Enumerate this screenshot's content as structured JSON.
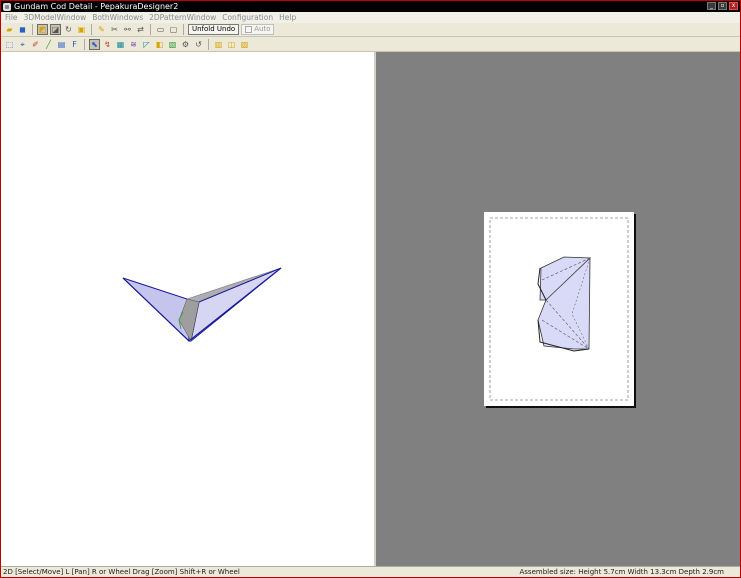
{
  "window": {
    "title": "Gundam Cod Detail - PepakuraDesigner2",
    "controls": [
      "_",
      "▫",
      "x"
    ]
  },
  "menu": [
    "File",
    "3DModelWindow",
    "BothWindows",
    "2DPatternWindow",
    "Configuration",
    "Help"
  ],
  "toolbar1": {
    "unfold_undo_label": "Unfold Undo",
    "auto_label": "Auto"
  },
  "icons": {
    "toolbar1": [
      "open-icon",
      "save-icon",
      "texture-on-icon",
      "shade-icon",
      "rotate-icon",
      "box-icon",
      "pencil-icon",
      "cut-icon",
      "join-icon",
      "move-part-icon",
      "page-single-icon",
      "page-fit-icon"
    ],
    "toolbar2": [
      "select-icon",
      "ruler-icon",
      "paint-icon",
      "line-icon",
      "edge-icon",
      "text-icon",
      "image-icon",
      "fold-icon",
      "chart-icon",
      "sort-icon",
      "flap-icon",
      "rotate-part-icon",
      "layer-icon",
      "zoom-icon",
      "pan-icon",
      "grid-icon",
      "lock-icon",
      "print-icon",
      "cut-line-icon"
    ]
  },
  "status": {
    "left": "2D [Select/Move] L [Pan] R or Wheel Drag [Zoom] Shift+R or Wheel",
    "right": "Assembled size: Height 5.7cm Width 13.3cm Depth 2.9cm"
  },
  "colors": {
    "model_fill": "#c8c8ee",
    "model_edge": "#1a1a9a",
    "pattern_fill": "#d9d9f8",
    "canvas_bg": "#808080"
  }
}
